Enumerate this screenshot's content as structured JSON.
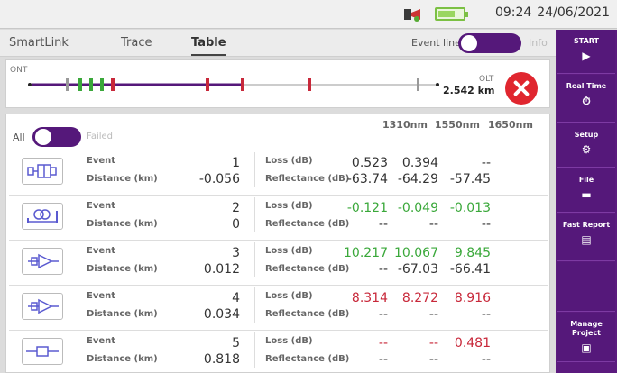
{
  "status": {
    "time": "09:24",
    "date": "24/06/2021",
    "battery_level": 0.7
  },
  "tabs": [
    {
      "label": "SmartLink",
      "active": false
    },
    {
      "label": "Trace",
      "active": false
    },
    {
      "label": "Table",
      "active": true
    }
  ],
  "event_line": {
    "label": "Event line",
    "enabled": true,
    "info_label": "Info"
  },
  "link_map": {
    "start_label": "ONT",
    "end_label": "OLT",
    "distance": "2.542 km"
  },
  "filter": {
    "all_label": "All",
    "failed_label": "Failed"
  },
  "wavelengths": [
    "1310nm",
    "1550nm",
    "1650nm"
  ],
  "row_labels": {
    "event": "Event",
    "distance": "Distance (km)",
    "loss": "Loss (dB)",
    "reflectance": "Reflectance (dB)"
  },
  "events": [
    {
      "icon": "splitter-icon",
      "number": "1",
      "distance": "-0.056",
      "loss": [
        "0.523",
        "0.394",
        "--"
      ],
      "reflectance": [
        "-63.74",
        "-64.29",
        "-57.45"
      ],
      "loss_status": "neutral"
    },
    {
      "icon": "connector-icon",
      "number": "2",
      "distance": "0",
      "loss": [
        "-0.121",
        "-0.049",
        "-0.013"
      ],
      "reflectance": [
        "--",
        "--",
        "--"
      ],
      "loss_status": "pass"
    },
    {
      "icon": "splitter-1xn-icon",
      "number": "3",
      "distance": "0.012",
      "loss": [
        "10.217",
        "10.067",
        "9.845"
      ],
      "reflectance": [
        "--",
        "-67.03",
        "-66.41"
      ],
      "loss_status": "pass"
    },
    {
      "icon": "splitter-1xn-icon",
      "number": "4",
      "distance": "0.034",
      "loss": [
        "8.314",
        "8.272",
        "8.916"
      ],
      "reflectance": [
        "--",
        "--",
        "--"
      ],
      "loss_status": "fail"
    },
    {
      "icon": "fiber-end-icon",
      "number": "5",
      "distance": "0.818",
      "loss": [
        "--",
        "--",
        "0.481"
      ],
      "reflectance": [
        "--",
        "--",
        "--"
      ],
      "loss_status": "fail"
    }
  ],
  "sidebar": [
    {
      "label": "START",
      "icon": "play-icon"
    },
    {
      "label": "Real Time",
      "icon": "timer-icon"
    },
    {
      "label": "Setup",
      "icon": "gear-icon"
    },
    {
      "label": "File",
      "icon": "folder-icon"
    },
    {
      "label": "Fast Report",
      "icon": "report-icon"
    },
    {
      "label": "",
      "icon": ""
    },
    {
      "label": "Manage Project",
      "icon": "project-icon"
    }
  ],
  "colors": {
    "accent": "#55187a",
    "pass": "#3aa83a",
    "fail": "#c8283a",
    "neutral": "#333333",
    "close": "#e0262f"
  }
}
